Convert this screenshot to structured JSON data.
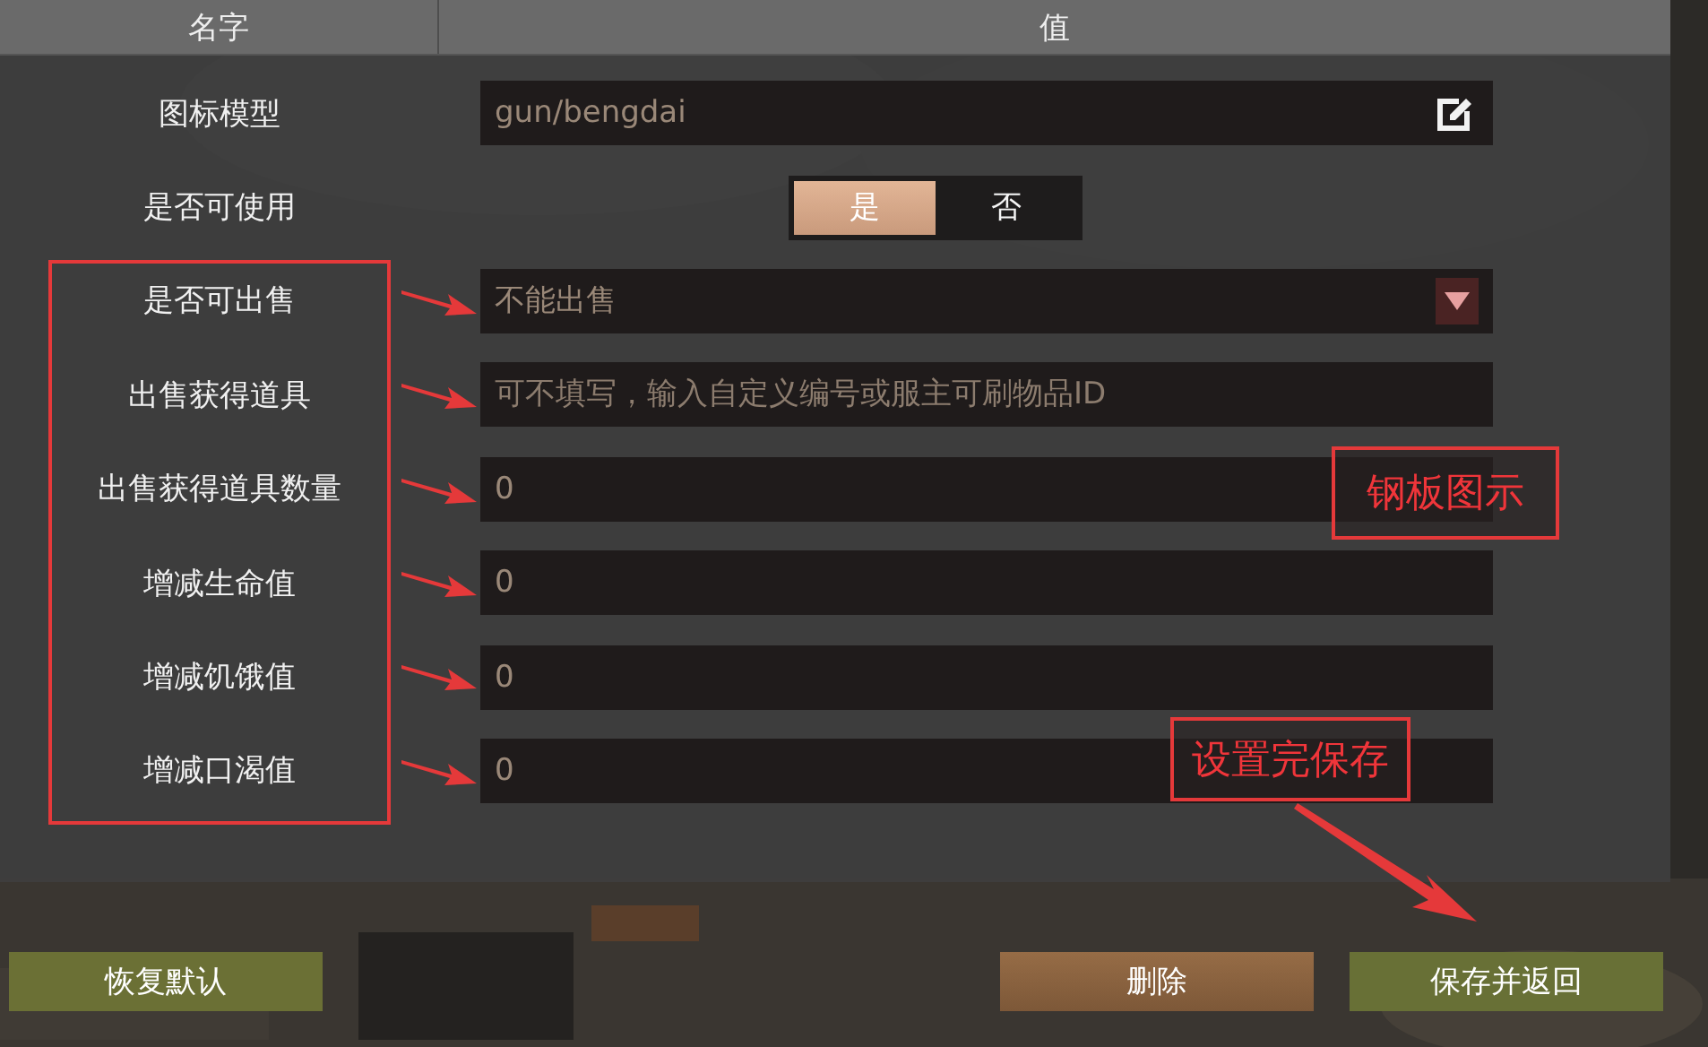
{
  "header": {
    "columns": [
      "名字",
      "值"
    ]
  },
  "rows": [
    {
      "kind": "icon-field",
      "label": "图标模型",
      "value": "gun/bengdai",
      "arrow": false
    },
    {
      "kind": "toggle",
      "label": "是否可使用",
      "arrow": false,
      "options": [
        {
          "label": "是",
          "selected": true
        },
        {
          "label": "否",
          "selected": false
        }
      ]
    },
    {
      "kind": "dropdown",
      "label": "是否可出售",
      "value": "不能出售",
      "arrow": true
    },
    {
      "kind": "text",
      "label": "出售获得道具",
      "placeholder": "可不填写，输入自定义编号或服主可刷物品ID",
      "arrow": true
    },
    {
      "kind": "text",
      "label": "出售获得道具数量",
      "value": "0",
      "arrow": true
    },
    {
      "kind": "text",
      "label": "增减生命值",
      "value": "0",
      "arrow": true
    },
    {
      "kind": "text",
      "label": "增减饥饿值",
      "value": "0",
      "arrow": true
    },
    {
      "kind": "text",
      "label": "增减口渴值",
      "value": "0",
      "arrow": true
    }
  ],
  "buttons": [
    {
      "label": "恢复默认",
      "kind": "default"
    },
    {
      "label": "删除",
      "kind": "delete"
    },
    {
      "label": "保存并返回",
      "kind": "save"
    }
  ],
  "annotations": [
    {
      "kind": "steel",
      "text": "钢板图示"
    },
    {
      "kind": "save",
      "text": "设置完保存"
    }
  ]
}
